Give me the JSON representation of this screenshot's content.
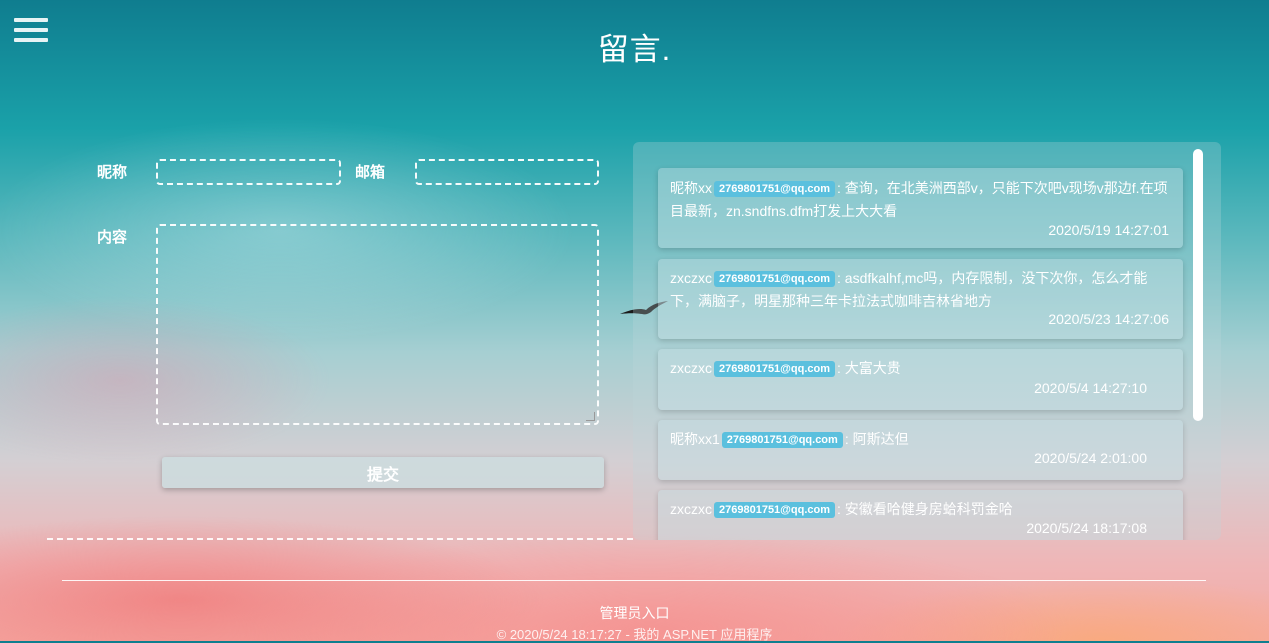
{
  "header": {
    "title": "留言."
  },
  "form": {
    "nickname_label": "昵称",
    "email_label": "邮箱",
    "content_label": "内容",
    "nickname_value": "",
    "email_value": "",
    "content_value": "",
    "submit_label": "提交"
  },
  "messages": [
    {
      "name": "昵称xx",
      "email": "2769801751@qq.com",
      "text": ": 查询，在北美洲西部v，只能下次吧v现场v那边f.在项目最新，zn.sndfns.dfm打发上大大看",
      "time": "2020/5/19 14:27:01"
    },
    {
      "name": "zxczxc",
      "email": "2769801751@qq.com",
      "text": ": asdfkalhf,mc吗，内存限制，没下次你，怎么才能下，满脑子，明星那种三年卡拉法式咖啡吉林省地方",
      "time": "2020/5/23 14:27:06"
    },
    {
      "name": "zxczxc",
      "email": "2769801751@qq.com",
      "text": ": 大富大贵",
      "time": "2020/5/4 14:27:10"
    },
    {
      "name": "昵称xx1",
      "email": "2769801751@qq.com",
      "text": ": 阿斯达但",
      "time": "2020/5/24 2:01:00"
    },
    {
      "name": "zxczxc",
      "email": "2769801751@qq.com",
      "text": ": 安徽看哈健身房蛤科罚金哈",
      "time": "2020/5/24 18:17:08"
    }
  ],
  "footer": {
    "admin_link": "管理员入口",
    "copyright": "© 2020/5/24 18:17:27 - 我的 ASP.NET 应用程序"
  },
  "icons": {
    "menu": "hamburger-menu-icon",
    "bird": "bird-silhouette"
  },
  "colors": {
    "badge": "#5bc0de",
    "sky_top": "#0f7d8f",
    "sky_bottom": "#f5a9a2"
  }
}
